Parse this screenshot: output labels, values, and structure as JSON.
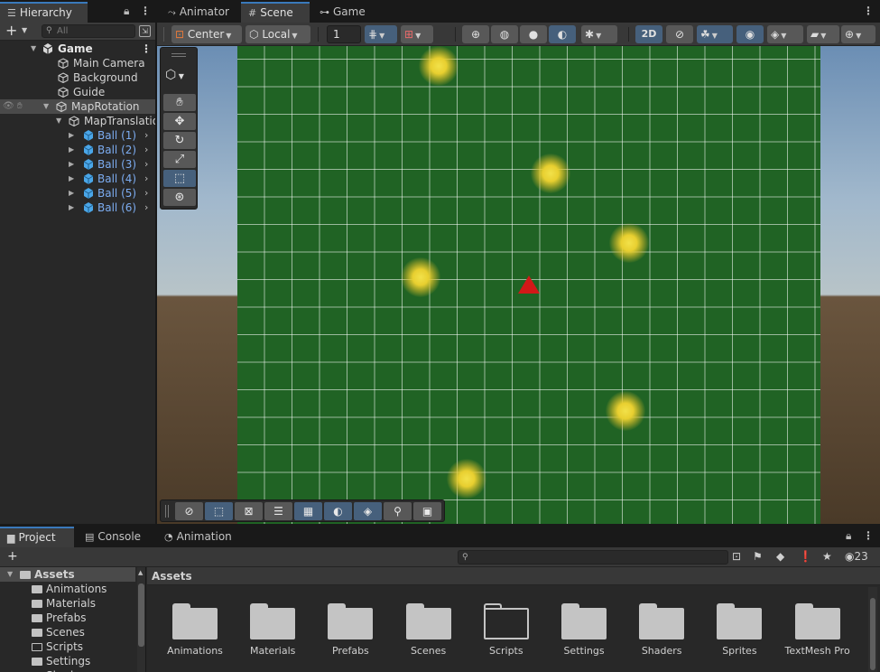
{
  "hierarchy": {
    "tab_label": "Hierarchy",
    "search_placeholder": "All",
    "items": [
      {
        "label": "Game",
        "depth": 0
      },
      {
        "label": "Main Camera",
        "depth": 1
      },
      {
        "label": "Background",
        "depth": 1
      },
      {
        "label": "Guide",
        "depth": 1
      },
      {
        "label": "MapRotation",
        "depth": 1
      },
      {
        "label": "MapTranslation",
        "depth": 2
      },
      {
        "label": "Ball (1)",
        "depth": 3
      },
      {
        "label": "Ball (2)",
        "depth": 3
      },
      {
        "label": "Ball (3)",
        "depth": 3
      },
      {
        "label": "Ball (4)",
        "depth": 3
      },
      {
        "label": "Ball (5)",
        "depth": 3
      },
      {
        "label": "Ball (6)",
        "depth": 3
      }
    ]
  },
  "scene": {
    "tabs": [
      {
        "label": "Animator",
        "active": false
      },
      {
        "label": "Scene",
        "active": true
      },
      {
        "label": "Game",
        "active": false
      }
    ],
    "toolbar": {
      "pivot_mode": "Center",
      "pivot_space": "Local",
      "grid_snap_value": "1",
      "mode_2d": "2D"
    }
  },
  "project": {
    "tabs": [
      {
        "label": "Project",
        "active": true
      },
      {
        "label": "Console",
        "active": false
      },
      {
        "label": "Animation",
        "active": false
      }
    ],
    "visibility_count": "23",
    "tree": {
      "root": "Assets",
      "children": [
        "Animations",
        "Materials",
        "Prefabs",
        "Scenes",
        "Scripts",
        "Settings",
        "Shaders"
      ]
    },
    "assets_header": "Assets",
    "assets": [
      {
        "label": "Animations",
        "empty": false
      },
      {
        "label": "Materials",
        "empty": false
      },
      {
        "label": "Prefabs",
        "empty": false
      },
      {
        "label": "Scenes",
        "empty": false
      },
      {
        "label": "Scripts",
        "empty": true
      },
      {
        "label": "Settings",
        "empty": false
      },
      {
        "label": "Shaders",
        "empty": false
      },
      {
        "label": "Sprites",
        "empty": false
      },
      {
        "label": "TextMesh Pro",
        "empty": false
      }
    ]
  },
  "colors": {
    "accent": "#3a79bb",
    "selection_blue": "#46607c",
    "prefab_text": "#7cacf0",
    "grid_green": "#206324",
    "ball_yellow": "#e8cf30",
    "player_red": "#d21818"
  }
}
